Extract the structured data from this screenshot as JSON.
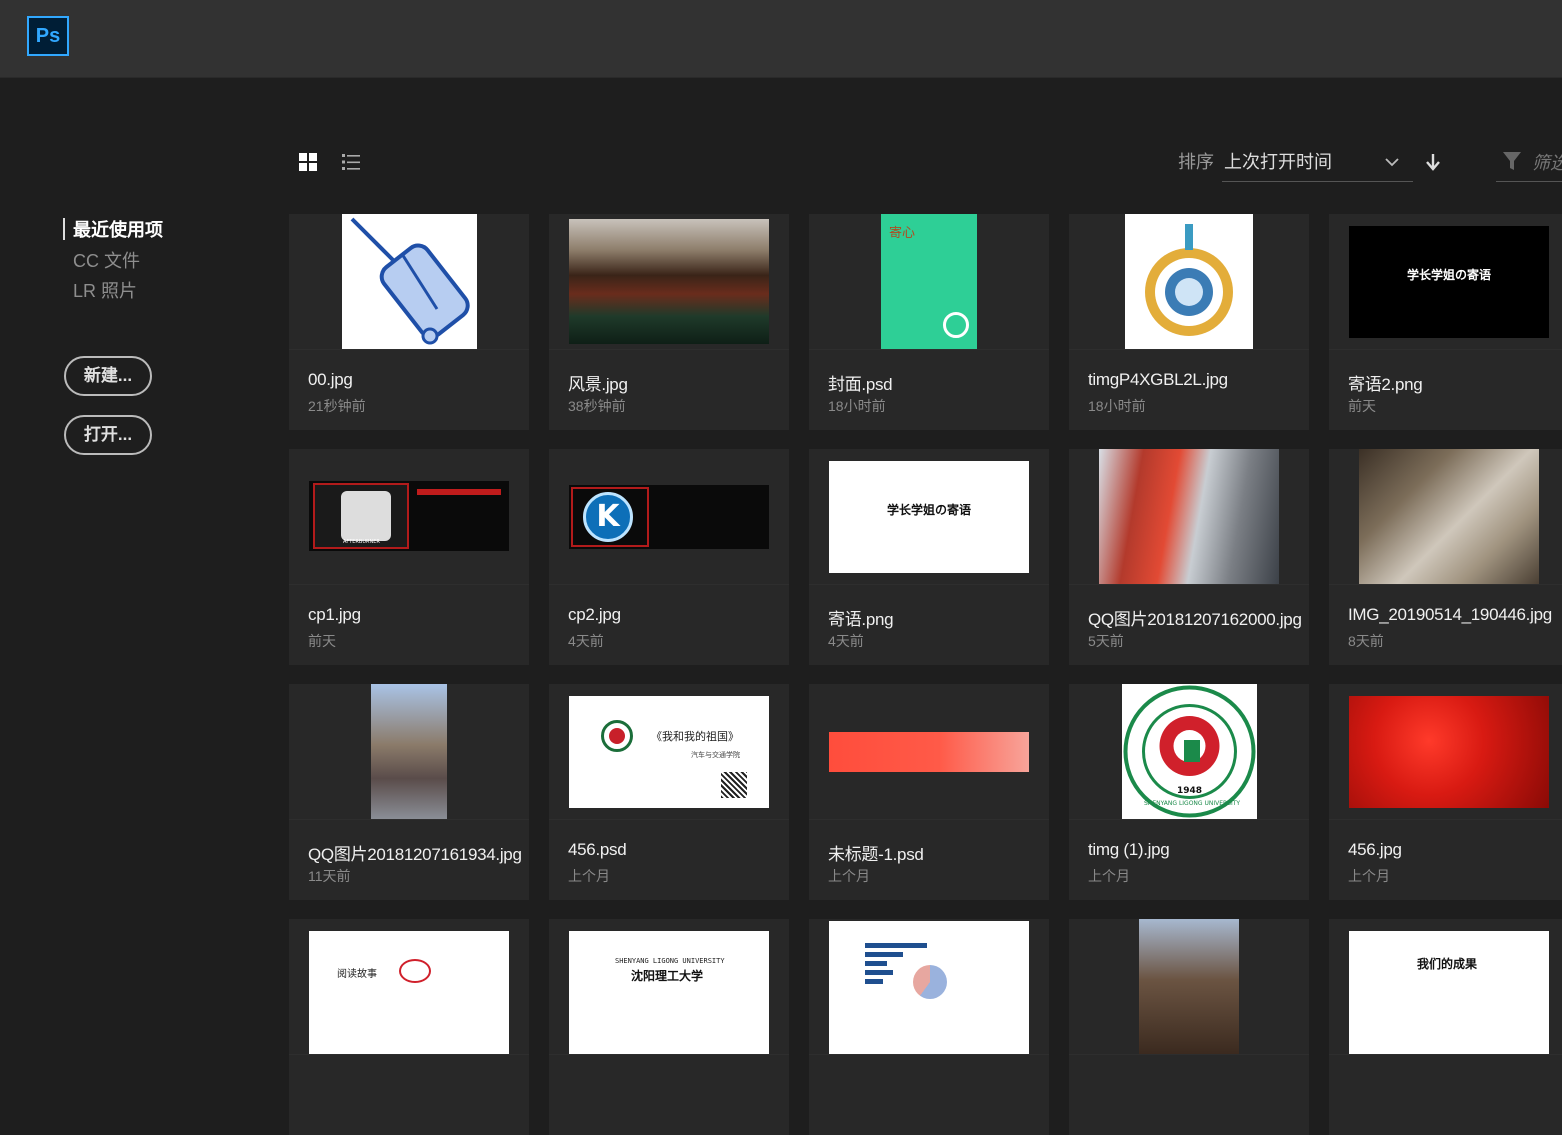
{
  "app": {
    "logo_text": "Ps"
  },
  "sidebar": {
    "nav": [
      {
        "label": "最近使用项",
        "active": true
      },
      {
        "label": "CC 文件",
        "active": false
      },
      {
        "label": "LR 照片",
        "active": false
      }
    ],
    "new_button": "新建...",
    "open_button": "打开..."
  },
  "toolbar": {
    "sort_label": "排序",
    "sort_value": "上次打开时间",
    "filter_placeholder": "筛选"
  },
  "files": [
    {
      "name": "00.jpg",
      "time": "21秒钟前",
      "thumb": "luggage"
    },
    {
      "name": "风景.jpg",
      "time": "38秒钟前",
      "thumb": "landscape"
    },
    {
      "name": "封面.psd",
      "time": "18小时前",
      "thumb": "green-cover",
      "thumb_text": "寄心"
    },
    {
      "name": "timgP4XGBL2L.jpg",
      "time": "18小时前",
      "thumb": "world-circle"
    },
    {
      "name": "寄语2.png",
      "time": "前天",
      "thumb": "black-text",
      "thumb_text": "学长学姐の寄语"
    },
    {
      "name": "cp1.jpg",
      "time": "前天",
      "thumb": "afterburner",
      "thumb_text": "AFTERBURNER"
    },
    {
      "name": "cp2.jpg",
      "time": "4天前",
      "thumb": "kombustor",
      "thumb_text": "K"
    },
    {
      "name": "寄语.png",
      "time": "4天前",
      "thumb": "white-text",
      "thumb_text": "学长学姐の寄语"
    },
    {
      "name": "QQ图片20181207162000.jpg",
      "time": "5天前",
      "thumb": "interview"
    },
    {
      "name": "IMG_20190514_190446.jpg",
      "time": "8天前",
      "thumb": "device"
    },
    {
      "name": "QQ图片20181207161934.jpg",
      "time": "11天前",
      "thumb": "street"
    },
    {
      "name": "456.psd",
      "time": "上个月",
      "thumb": "card-white",
      "thumb_text": "《我和我的祖国》",
      "thumb_sub": "汽车与交通学院"
    },
    {
      "name": "未标题-1.psd",
      "time": "上个月",
      "thumb": "red-gradient"
    },
    {
      "name": "timg (1).jpg",
      "time": "上个月",
      "thumb": "seal",
      "thumb_text": "1948",
      "thumb_sub": "SHENYANG LIGONG UNIVERSITY"
    },
    {
      "name": "456.jpg",
      "time": "上个月",
      "thumb": "red-bokeh"
    },
    {
      "name": "",
      "time": "",
      "thumb": "diagram",
      "thumb_text": "阅读故事"
    },
    {
      "name": "",
      "time": "",
      "thumb": "uni-title",
      "thumb_text": "沈阳理工大学",
      "thumb_sub": "SHENYANG LIGONG UNIVERSITY"
    },
    {
      "name": "",
      "time": "",
      "thumb": "barchart"
    },
    {
      "name": "",
      "time": "",
      "thumb": "tree"
    },
    {
      "name": "",
      "time": "",
      "thumb": "achievement",
      "thumb_text": "我们的成果"
    }
  ]
}
